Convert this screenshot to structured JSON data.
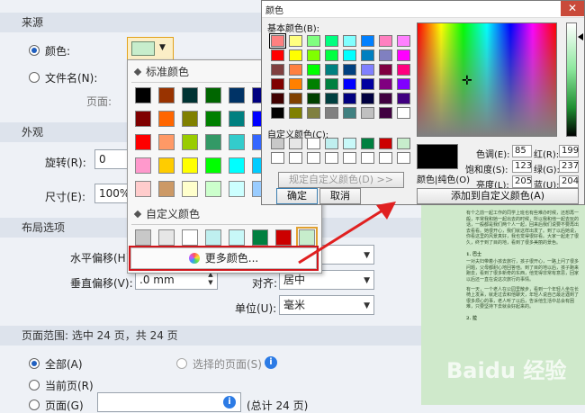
{
  "source": {
    "heading": "来源",
    "color_label": "颜色:",
    "filename_label": "文件名(N):",
    "page_label": "页面:"
  },
  "appearance": {
    "heading": "外观",
    "rotate_label": "旋转(R):",
    "rotate_value": "0",
    "size_label": "尺寸(E):",
    "size_value": "100%"
  },
  "layout": {
    "heading": "布局选项",
    "hoffset_label": "水平偏移(H):",
    "voffset_label": "垂直偏移(V):",
    "voffset_value": ".0 mm",
    "align_label": "对齐:",
    "align_value": "居中",
    "unit_label": "单位(U):",
    "unit_value": "毫米"
  },
  "page_range": {
    "heading": "页面范围: 选中 24 页，共 24 页",
    "all_label": "全部(A)",
    "selected_label": "选择的页面(S)",
    "current_label": "当前页(R)",
    "pages_label": "页面(G)",
    "total_text": "(总计 24 页)"
  },
  "dropdown": {
    "standard_heading": "标准颜色",
    "custom_heading": "自定义颜色",
    "more_colors": "更多颜色...",
    "standard_colors": [
      [
        "#000000",
        "#993300",
        "#003333",
        "#006600",
        "#003366",
        "#000080",
        "#333399"
      ],
      [
        "#800000",
        "#ff6600",
        "#808000",
        "#008000",
        "#008080",
        "#0000ff",
        "#666699"
      ],
      [
        "#ff0000",
        "#ff9966",
        "#99cc00",
        "#339966",
        "#33cccc",
        "#3366ff",
        "#800080"
      ],
      [
        "#ff99cc",
        "#ffcc00",
        "#ffff00",
        "#00ff00",
        "#00ffff",
        "#00ccff",
        "#993366"
      ],
      [
        "#ffcccc",
        "#cc9966",
        "#ffffcc",
        "#ccffcc",
        "#ccffff",
        "#99ccff",
        "#cc99ff"
      ]
    ],
    "custom_colors": [
      "#c8c8c8",
      "#e6e6e6",
      "#ffffff",
      "#bfefef",
      "#c8f8f8",
      "#008040",
      "#cc0000",
      "#c7edcc"
    ]
  },
  "color_dialog": {
    "title": "颜色",
    "basic_label": "基本颜色(B):",
    "custom_label": "自定义颜色(C):",
    "define_button": "规定自定义颜色(D) >>",
    "ok_button": "确定",
    "cancel_button": "取消",
    "solid_label": "颜色|纯色(O)",
    "add_button": "添加到自定义颜色(A)",
    "hue_label": "色调(E):",
    "hue_value": "85",
    "sat_label": "饱和度(S):",
    "sat_value": "123",
    "lum_label": "亮度(L):",
    "lum_value": "205",
    "red_label": "红(R):",
    "red_value": "199",
    "green_label": "绿(G):",
    "green_value": "237",
    "blue_label": "蓝(U):",
    "blue_value": "204",
    "basic_colors": [
      [
        "#ff8080",
        "#ffff80",
        "#80ff80",
        "#00ff80",
        "#80ffff",
        "#0080ff",
        "#ff80c0",
        "#ff80ff"
      ],
      [
        "#ff0000",
        "#ffff00",
        "#80ff00",
        "#00ff40",
        "#00ffff",
        "#0080c0",
        "#8080c0",
        "#ff00ff"
      ],
      [
        "#804040",
        "#ff8040",
        "#00ff00",
        "#008080",
        "#004080",
        "#8080ff",
        "#800040",
        "#ff0080"
      ],
      [
        "#800000",
        "#ff8000",
        "#008000",
        "#008040",
        "#0000ff",
        "#0000a0",
        "#800080",
        "#8000ff"
      ],
      [
        "#400000",
        "#804000",
        "#004000",
        "#004040",
        "#000080",
        "#000040",
        "#400040",
        "#400080"
      ],
      [
        "#000000",
        "#808000",
        "#808040",
        "#808080",
        "#408080",
        "#c0c0c0",
        "#400040",
        "#ffffff"
      ]
    ],
    "custom_colors": [
      "#c8c8c8",
      "#e6e6e6",
      "#ffffff",
      "#bfefef",
      "#c8f8f8",
      "#008040",
      "#cc0000",
      "#c7edcc",
      "#ffffff",
      "#ffffff",
      "#ffffff",
      "#ffffff",
      "#ffffff",
      "#ffffff",
      "#ffffff",
      "#ffffff"
    ]
  },
  "document": {
    "heading1": "1. 巴士",
    "heading2": "2. 拉",
    "paragraphs": [
      "有个之前一起工作的同学上班也有些难办时候，还想再一般，平常我和她一起出去的时候，所以我和他一起去玩的话，一般都是我们两个人一起，回来后我们说要不要再出去看看。她很开心，我们就这样出发了。到了以后她说，你看这里的风景真好，我也觉得很好看。大家一起走了很久，终于到了目的地，看到了很多美丽的景色。",
      "一对夫妇带着小孩去旅行，孩子很开心，一路上问了很多问题，父母都耐心地回答他。到了目的地以后，孩子跑来跑去，看到了很多新奇的东西，他觉得非常有意思，回家以后还一直在说这次旅行的事情。",
      "有一天，一个老人在公园里散步，看到一个年轻人坐在长椅上发呆，就走过去和他聊天，年轻人说自己最近遇到了很多烦心的事，老人听了以后，告诉他生活中总会有困难，只要坚持下去就会好起来的。"
    ]
  },
  "watermark": "Baidu 经验"
}
